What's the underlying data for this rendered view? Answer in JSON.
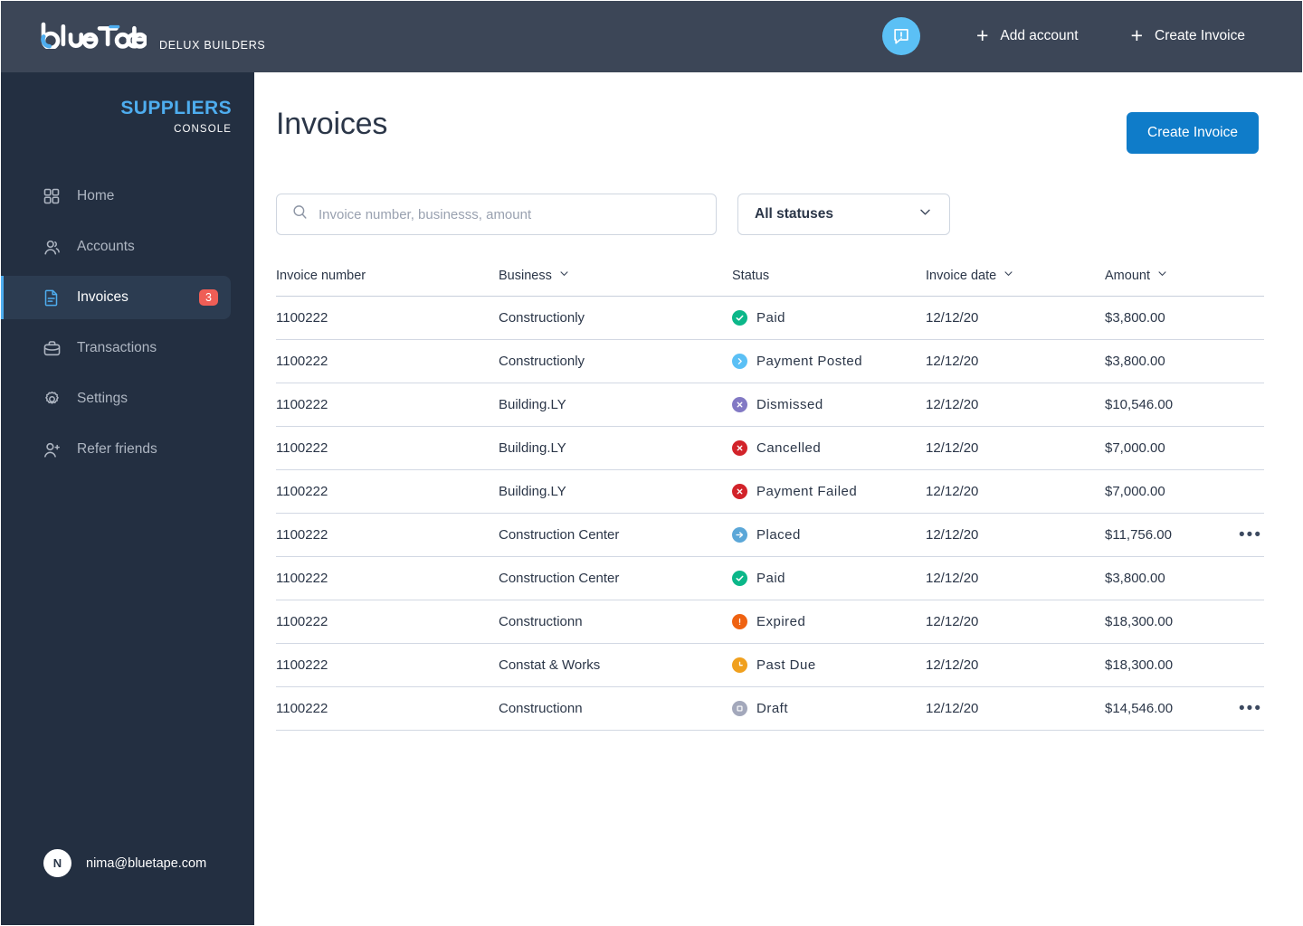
{
  "topbar": {
    "logo_text": "blueTape",
    "company": "DELUX BUILDERS",
    "chat_icon": "message-alert-icon",
    "add_account_label": "Add account",
    "create_invoice_label": "Create Invoice",
    "plus_glyph": "+",
    "background": "#3c4657",
    "accent": "#5bc0f5"
  },
  "sidebar": {
    "console_title": "SUPPLIERS",
    "console_subtitle": "CONSOLE",
    "title_color": "#4eadef",
    "background": "#232f41",
    "active_background": "#2c3c51",
    "items": [
      {
        "label": "Home",
        "icon": "grid-icon",
        "active": false,
        "badge": ""
      },
      {
        "label": "Accounts",
        "icon": "people-icon",
        "active": false,
        "badge": ""
      },
      {
        "label": "Invoices",
        "icon": "document-icon",
        "active": true,
        "badge": "3"
      },
      {
        "label": "Transactions",
        "icon": "briefcase-icon",
        "active": false,
        "badge": ""
      },
      {
        "label": "Settings",
        "icon": "gear-icon",
        "active": false,
        "badge": ""
      },
      {
        "label": "Refer friends",
        "icon": "person-plus-icon",
        "active": false,
        "badge": ""
      }
    ],
    "badge_color": "#ef5e56",
    "user": {
      "initial": "N",
      "email": "nima@bluetape.com"
    }
  },
  "main": {
    "page_title": "Invoices",
    "create_invoice_label": "Create Invoice",
    "create_invoice_color": "#0f7cc9",
    "search": {
      "placeholder": "Invoice number, businesss, amount",
      "value": "",
      "icon": "search-icon"
    },
    "status_filter": {
      "selected": "All statuses",
      "icon": "chevron-down-icon"
    },
    "table": {
      "columns": [
        {
          "label": "Invoice number",
          "sortable": false
        },
        {
          "label": "Business",
          "sortable": true
        },
        {
          "label": "Status",
          "sortable": false
        },
        {
          "label": "Invoice date",
          "sortable": true
        },
        {
          "label": "Amount",
          "sortable": true
        }
      ],
      "rows": [
        {
          "invoice_number": "1100222",
          "business": "Constructionly",
          "status": "Paid",
          "status_icon": "check-circle-icon",
          "status_color": "#0bb789",
          "date": "12/12/20",
          "amount": "$3,800.00",
          "menu": false
        },
        {
          "invoice_number": "1100222",
          "business": "Constructionly",
          "status": "Payment Posted",
          "status_icon": "chevron-circle-icon",
          "status_color": "#5bc0f5",
          "date": "12/12/20",
          "amount": "$3,800.00",
          "menu": false
        },
        {
          "invoice_number": "1100222",
          "business": "Building.LY",
          "status": "Dismissed",
          "status_icon": "x-circle-icon",
          "status_color": "#8279c4",
          "date": "12/12/20",
          "amount": "$10,546.00",
          "menu": false
        },
        {
          "invoice_number": "1100222",
          "business": "Building.LY",
          "status": "Cancelled",
          "status_icon": "x-circle-icon",
          "status_color": "#d2232a",
          "date": "12/12/20",
          "amount": "$7,000.00",
          "menu": false
        },
        {
          "invoice_number": "1100222",
          "business": "Building.LY",
          "status": "Payment Failed",
          "status_icon": "x-circle-icon",
          "status_color": "#d2232a",
          "date": "12/12/20",
          "amount": "$7,000.00",
          "menu": false
        },
        {
          "invoice_number": "1100222",
          "business": "Construction Center",
          "status": "Placed",
          "status_icon": "arrow-circle-icon",
          "status_color": "#5ba7d8",
          "date": "12/12/20",
          "amount": "$11,756.00",
          "menu": true
        },
        {
          "invoice_number": "1100222",
          "business": "Construction Center",
          "status": "Paid",
          "status_icon": "check-circle-icon",
          "status_color": "#0bb789",
          "date": "12/12/20",
          "amount": "$3,800.00",
          "menu": false
        },
        {
          "invoice_number": "1100222",
          "business": "Constructionn",
          "status": "Expired",
          "status_icon": "exclamation-circle-icon",
          "status_color": "#ef6211",
          "date": "12/12/20",
          "amount": "$18,300.00",
          "menu": false
        },
        {
          "invoice_number": "1100222",
          "business": "Constat & Works",
          "status": "Past Due",
          "status_icon": "clock-circle-icon",
          "status_color": "#f0a01e",
          "date": "12/12/20",
          "amount": "$18,300.00",
          "menu": false
        },
        {
          "invoice_number": "1100222",
          "business": "Constructionn",
          "status": "Draft",
          "status_icon": "square-circle-icon",
          "status_color": "#a3a8bb",
          "date": "12/12/20",
          "amount": "$14,546.00",
          "menu": true
        }
      ],
      "menu_glyph": "•••"
    }
  }
}
